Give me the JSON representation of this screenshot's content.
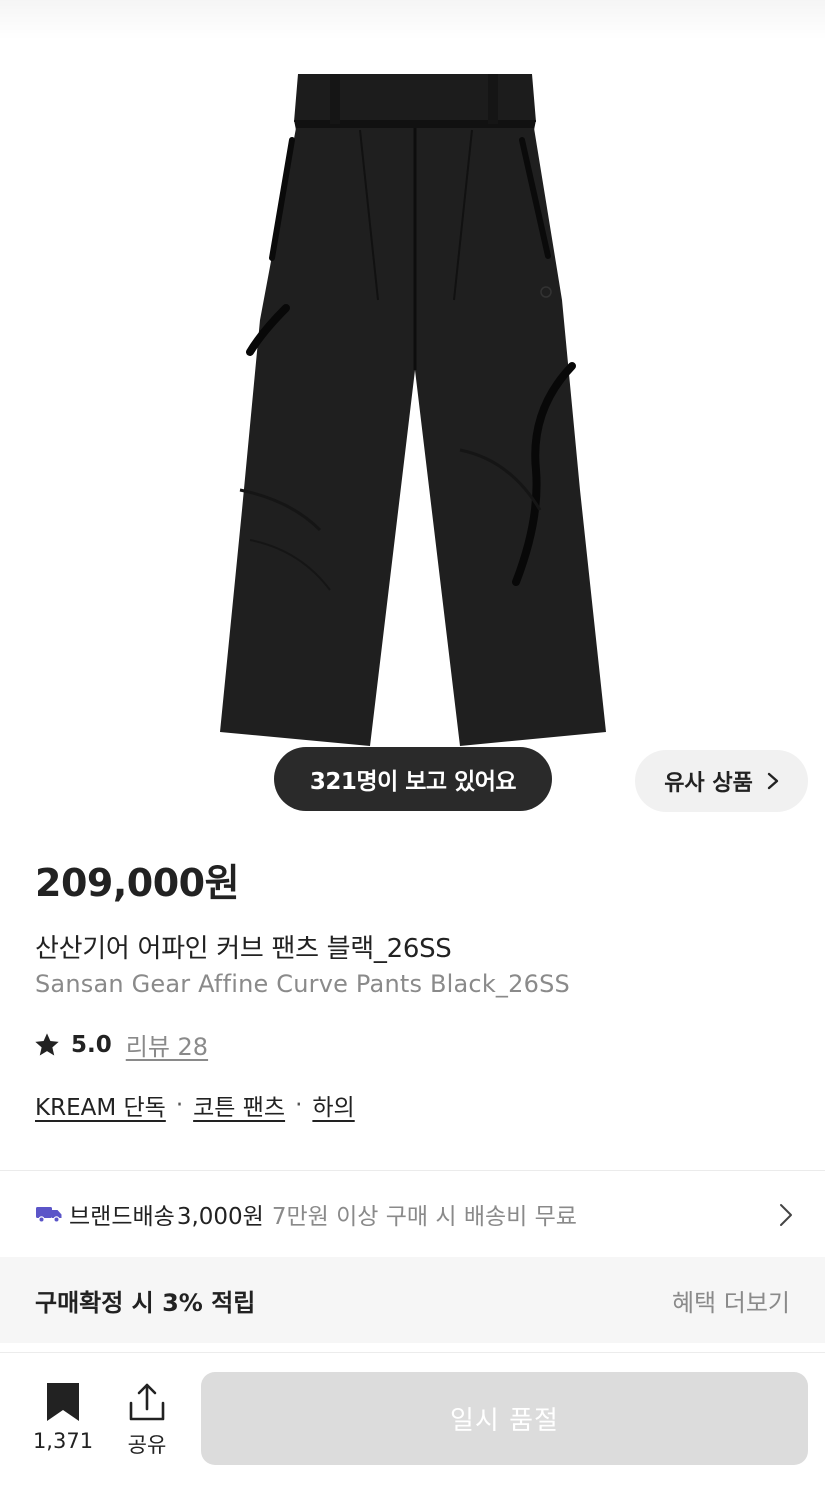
{
  "hero": {
    "viewers_text": "321명이 보고 있어요",
    "similar_label": "유사 상품"
  },
  "product": {
    "price": "209,000원",
    "name_ko": "산산기어 어파인 커브 팬츠 블랙_26SS",
    "name_en": "Sansan Gear Affine Curve Pants Black_26SS",
    "rating": "5.0",
    "review_link": "리뷰 28",
    "tags": [
      "KREAM 단독",
      "코튼 팬츠",
      "하의"
    ],
    "tag_separator": "·"
  },
  "shipping": {
    "label": "브랜드배송",
    "price": "3,000원",
    "note": "7만원 이상 구매 시 배송비 무료"
  },
  "benefit": {
    "title": "구매확정 시 3% 적립",
    "more": "혜택 더보기"
  },
  "bottom_bar": {
    "bookmark_count": "1,371",
    "share_label": "공유",
    "cta_label": "일시 품절"
  },
  "colors": {
    "text": "#222222",
    "muted": "#8a8a8a",
    "pill_dark": "#2a2a2a",
    "ship_icon": "#5b55c8",
    "disabled_button": "#dcdcdc"
  },
  "icons": {
    "star": "star-icon",
    "truck": "truck-icon",
    "chevron": "chevron-right-icon",
    "bookmark": "bookmark-icon",
    "share": "share-icon"
  }
}
